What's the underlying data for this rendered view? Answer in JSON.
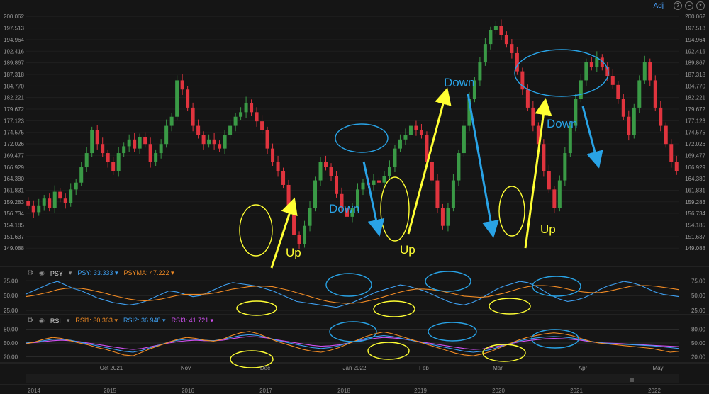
{
  "header": {
    "adj_label": "Adj"
  },
  "indicators": {
    "psy": {
      "name": "PSY",
      "psy_label": "PSY:",
      "psy_value": "33.333",
      "psyma_label": "PSYMA:",
      "psyma_value": "47.222"
    },
    "rsi": {
      "name": "RSI",
      "rsi1_label": "RSI1:",
      "rsi1_value": "30.363",
      "rsi2_label": "RSI2:",
      "rsi2_value": "36.948",
      "rsi3_label": "RSI3:",
      "rsi3_value": "41.721"
    }
  },
  "annotations": [
    {
      "text": "Up",
      "color": "#ffff33"
    },
    {
      "text": "Down",
      "color": "#29a3e6"
    },
    {
      "text": "Up",
      "color": "#ffff33"
    },
    {
      "text": "Down",
      "color": "#29a3e6"
    },
    {
      "text": "Up",
      "color": "#ffff33"
    },
    {
      "text": "Down",
      "color": "#29a3e6"
    }
  ],
  "colors": {
    "background": "#151515",
    "bull": "#3a9a46",
    "bear": "#e0343e",
    "psy": "#3e9ff0",
    "psyma": "#f08a24",
    "rsi1": "#f08a24",
    "rsi2": "#3e9ff0",
    "rsi3": "#d050f0",
    "up_arrow": "#ffff33",
    "down_arrow": "#29a3e6"
  },
  "chart_data": {
    "type": "candlestick",
    "price_axis": {
      "ylim": [
        146.0,
        201.5
      ],
      "ticks": [
        "200.062",
        "197.513",
        "194.964",
        "192.416",
        "189.867",
        "187.318",
        "184.770",
        "182.221",
        "179.672",
        "177.123",
        "174.575",
        "172.026",
        "169.477",
        "166.929",
        "164.380",
        "161.831",
        "159.283",
        "156.734",
        "154.185",
        "151.637",
        "149.088"
      ]
    },
    "month_labels": [
      "Oct 2021",
      "Nov",
      "Dec",
      "Jan 2022",
      "Feb",
      "Mar",
      "Apr",
      "May"
    ],
    "year_labels": [
      "2014",
      "2015",
      "2016",
      "2017",
      "2018",
      "2019",
      "2020",
      "2021",
      "2022"
    ],
    "psy_axis": {
      "ticks": [
        "75.00",
        "50.00",
        "25.00"
      ],
      "ylim": [
        20,
        85
      ]
    },
    "rsi_axis": {
      "ticks": [
        "80.00",
        "50.00",
        "20.00"
      ],
      "ylim": [
        10,
        90
      ]
    },
    "candles": [
      [
        159.5,
        158.5
      ],
      [
        158.5,
        157.0
      ],
      [
        157.0,
        158.5
      ],
      [
        158.5,
        160.0
      ],
      [
        160.0,
        158.0
      ],
      [
        158.0,
        161.5
      ],
      [
        161.5,
        160.0
      ],
      [
        160.0,
        159.0
      ],
      [
        159.0,
        162.0
      ],
      [
        162.0,
        163.5
      ],
      [
        163.5,
        167.0
      ],
      [
        167.0,
        170.0
      ],
      [
        170.0,
        175.0
      ],
      [
        175.0,
        172.0
      ],
      [
        172.0,
        170.0
      ],
      [
        170.0,
        168.0
      ],
      [
        168.0,
        166.0
      ],
      [
        166.0,
        170.0
      ],
      [
        170.0,
        171.5
      ],
      [
        171.5,
        173.0
      ],
      [
        173.0,
        171.0
      ],
      [
        171.0,
        173.5
      ],
      [
        173.5,
        172.0
      ],
      [
        172.0,
        168.0
      ],
      [
        168.0,
        170.0
      ],
      [
        170.0,
        172.0
      ],
      [
        172.0,
        176.0
      ],
      [
        176.0,
        178.0
      ],
      [
        178.0,
        186.0
      ],
      [
        186.0,
        184.0
      ],
      [
        184.0,
        180.0
      ],
      [
        180.0,
        176.0
      ],
      [
        176.0,
        174.0
      ],
      [
        174.0,
        172.0
      ],
      [
        172.0,
        173.0
      ],
      [
        173.0,
        172.0
      ],
      [
        172.0,
        171.0
      ],
      [
        171.0,
        174.0
      ],
      [
        174.0,
        176.0
      ],
      [
        176.0,
        178.0
      ],
      [
        178.0,
        179.0
      ],
      [
        179.0,
        181.0
      ],
      [
        181.0,
        179.0
      ],
      [
        179.0,
        177.0
      ],
      [
        177.0,
        175.0
      ],
      [
        175.0,
        171.0
      ],
      [
        171.0,
        168.0
      ],
      [
        168.0,
        166.0
      ],
      [
        166.0,
        163.0
      ],
      [
        163.0,
        158.0
      ],
      [
        158.0,
        152.0
      ],
      [
        152.0,
        150.0
      ],
      [
        150.0,
        154.0
      ],
      [
        154.0,
        158.0
      ],
      [
        158.0,
        164.0
      ],
      [
        164.0,
        168.0
      ],
      [
        168.0,
        167.0
      ],
      [
        167.0,
        165.0
      ],
      [
        165.0,
        161.0
      ],
      [
        161.0,
        158.0
      ],
      [
        158.0,
        156.0
      ],
      [
        156.0,
        158.0
      ],
      [
        158.0,
        162.0
      ],
      [
        162.0,
        163.5
      ],
      [
        163.5,
        163.0
      ],
      [
        163.0,
        164.0
      ],
      [
        164.0,
        163.5
      ],
      [
        163.5,
        165.0
      ],
      [
        165.0,
        167.0
      ],
      [
        167.0,
        171.0
      ],
      [
        171.0,
        173.0
      ],
      [
        173.0,
        174.0
      ],
      [
        174.0,
        176.0
      ],
      [
        176.0,
        175.0
      ],
      [
        175.0,
        174.0
      ],
      [
        174.0,
        168.0
      ],
      [
        168.0,
        164.0
      ],
      [
        164.0,
        158.0
      ],
      [
        158.0,
        154.0
      ],
      [
        154.0,
        158.0
      ],
      [
        158.0,
        164.0
      ],
      [
        164.0,
        170.0
      ],
      [
        170.0,
        176.0
      ],
      [
        176.0,
        182.0
      ],
      [
        182.0,
        186.0
      ],
      [
        186.0,
        190.0
      ],
      [
        190.0,
        194.0
      ],
      [
        194.0,
        197.0
      ],
      [
        197.0,
        198.0
      ],
      [
        198.0,
        196.0
      ],
      [
        196.0,
        194.0
      ],
      [
        194.0,
        192.0
      ],
      [
        192.0,
        188.0
      ],
      [
        188.0,
        184.0
      ],
      [
        184.0,
        180.0
      ],
      [
        180.0,
        176.0
      ],
      [
        176.0,
        172.0
      ],
      [
        172.0,
        166.0
      ],
      [
        166.0,
        162.0
      ],
      [
        162.0,
        158.0
      ],
      [
        158.0,
        164.0
      ],
      [
        164.0,
        170.0
      ],
      [
        170.0,
        176.0
      ],
      [
        176.0,
        182.0
      ],
      [
        182.0,
        186.0
      ],
      [
        186.0,
        190.0
      ],
      [
        190.0,
        189.0
      ],
      [
        189.0,
        191.0
      ],
      [
        191.0,
        189.0
      ],
      [
        189.0,
        187.0
      ],
      [
        187.0,
        185.0
      ],
      [
        185.0,
        182.0
      ],
      [
        182.0,
        178.0
      ],
      [
        178.0,
        174.0
      ],
      [
        174.0,
        180.0
      ],
      [
        180.0,
        186.0
      ],
      [
        186.0,
        190.0
      ],
      [
        190.0,
        186.0
      ],
      [
        186.0,
        180.0
      ],
      [
        180.0,
        176.0
      ],
      [
        176.0,
        172.0
      ],
      [
        172.0,
        168.0
      ],
      [
        168.0,
        166.0
      ]
    ],
    "psy": [
      52,
      58,
      64,
      70,
      74,
      68,
      62,
      58,
      52,
      46,
      42,
      38,
      36,
      34,
      36,
      40,
      46,
      52,
      58,
      56,
      52,
      48,
      50,
      56,
      62,
      68,
      72,
      70,
      68,
      66,
      62,
      58,
      52,
      46,
      40,
      38,
      36,
      34,
      32,
      30,
      34,
      38,
      44,
      50,
      56,
      60,
      64,
      68,
      66,
      62,
      58,
      52,
      46,
      40,
      36,
      34,
      38,
      44,
      52,
      60,
      66,
      70,
      74,
      72,
      66,
      58,
      50,
      44,
      40,
      42,
      46,
      52,
      60,
      66,
      70,
      74,
      72,
      68,
      62,
      56,
      52,
      50,
      48
    ],
    "psyma": [
      48,
      50,
      53,
      56,
      60,
      62,
      63,
      62,
      60,
      57,
      54,
      50,
      47,
      44,
      42,
      41,
      42,
      44,
      47,
      50,
      52,
      52,
      52,
      53,
      55,
      58,
      61,
      63,
      65,
      66,
      66,
      65,
      62,
      59,
      55,
      51,
      47,
      43,
      40,
      38,
      37,
      37,
      38,
      41,
      44,
      48,
      52,
      56,
      59,
      61,
      61,
      60,
      58,
      55,
      52,
      49,
      48,
      47,
      48,
      51,
      54,
      58,
      62,
      65,
      67,
      67,
      66,
      64,
      61,
      58,
      56,
      55,
      55,
      57,
      60,
      63,
      66,
      67,
      67,
      66,
      64,
      62,
      60
    ],
    "rsi1": [
      48,
      52,
      58,
      62,
      60,
      55,
      50,
      46,
      40,
      36,
      30,
      24,
      22,
      30,
      38,
      45,
      52,
      58,
      62,
      60,
      56,
      54,
      58,
      66,
      72,
      75,
      70,
      62,
      54,
      48,
      42,
      36,
      32,
      30,
      34,
      40,
      48,
      56,
      64,
      70,
      74,
      70,
      64,
      58,
      52,
      46,
      40,
      34,
      28,
      24,
      22,
      26,
      32,
      40,
      48,
      56,
      62,
      66,
      70,
      72,
      70,
      66,
      60,
      54,
      50,
      48,
      46,
      44,
      42,
      40,
      38,
      34,
      30,
      32
    ],
    "rsi2": [
      50,
      52,
      55,
      58,
      58,
      56,
      52,
      48,
      44,
      40,
      36,
      32,
      30,
      34,
      40,
      46,
      52,
      56,
      58,
      58,
      56,
      55,
      58,
      62,
      66,
      68,
      66,
      62,
      56,
      52,
      48,
      44,
      40,
      38,
      40,
      44,
      50,
      55,
      60,
      64,
      66,
      64,
      60,
      56,
      52,
      48,
      44,
      40,
      36,
      32,
      30,
      32,
      36,
      42,
      48,
      54,
      58,
      61,
      63,
      64,
      63,
      61,
      58,
      54,
      51,
      49,
      48,
      47,
      46,
      45,
      44,
      42,
      40,
      38
    ],
    "rsi3": [
      50,
      51,
      53,
      55,
      56,
      55,
      53,
      50,
      47,
      44,
      41,
      38,
      36,
      38,
      42,
      46,
      50,
      53,
      55,
      56,
      55,
      55,
      56,
      59,
      62,
      64,
      63,
      61,
      57,
      54,
      51,
      48,
      45,
      43,
      44,
      46,
      50,
      54,
      57,
      60,
      62,
      61,
      59,
      56,
      53,
      50,
      47,
      44,
      41,
      38,
      36,
      37,
      40,
      44,
      48,
      52,
      55,
      57,
      59,
      60,
      59,
      58,
      56,
      53,
      51,
      50,
      49,
      48,
      47,
      46,
      45,
      44,
      43,
      42
    ]
  }
}
